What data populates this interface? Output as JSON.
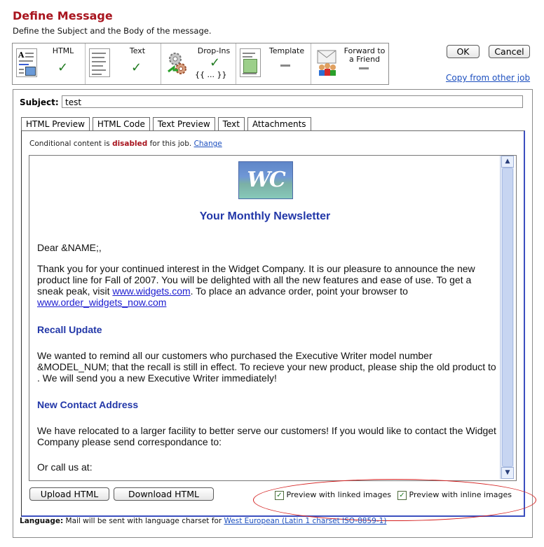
{
  "header": {
    "title": "Define Message",
    "subtitle": "Define the Subject and the Body of the message."
  },
  "steps": [
    {
      "label": "HTML",
      "status": "✓"
    },
    {
      "label": "Text",
      "status": "✓"
    },
    {
      "label": "Drop-Ins",
      "status": "✓",
      "extra": "{{ ... }}"
    },
    {
      "label": "Template",
      "status": "—"
    },
    {
      "label": "Forward to a Friend",
      "status": "—"
    }
  ],
  "actions": {
    "ok": "OK",
    "cancel": "Cancel",
    "copy_link": "Copy from other job"
  },
  "subject": {
    "label": "Subject:",
    "value": "test"
  },
  "tabs": [
    "HTML Preview",
    "HTML Code",
    "Text Preview",
    "Text",
    "Attachments"
  ],
  "conditional": {
    "prefix": "Conditional content is ",
    "state": "disabled",
    "suffix": " for this job. ",
    "change": "Change"
  },
  "preview": {
    "logo_text": "WC",
    "newsletter_title": "Your Monthly Newsletter",
    "greeting": "Dear &NAME;,",
    "para1_a": "Thank you for your continued interest in the Widget Company. It is our pleasure to announce the new product line for Fall of 2007. You will be delighted with all the new features and ease of use. To get a sneak peak, visit ",
    "link1": "www.widgets.com",
    "para1_b": ". To place an advance order, point your browser to ",
    "link2": "www.order_widgets_now.com",
    "heading1": "Recall Update",
    "para2": "We wanted to remind all our customers who purchased the Executive Writer model number &MODEL_NUM; that the recall is still in effect. To recieve your new product, please ship the old product to . We will send you a new Executive Writer immediately!",
    "heading2": "New Contact Address",
    "para3": "We have relocated to a larger facility to better serve our customers! If you would like to contact the Widget Company please send correspondance to:",
    "para4": "Or call us at:"
  },
  "buttons": {
    "upload": "Upload HTML",
    "download": "Download HTML"
  },
  "options": {
    "linked": "Preview with linked images",
    "inline": "Preview with inline images"
  },
  "language": {
    "label": "Language:",
    "text": " Mail will be sent with language charset for ",
    "link": "West European (Latin 1 charset ISO-8859-1)"
  }
}
